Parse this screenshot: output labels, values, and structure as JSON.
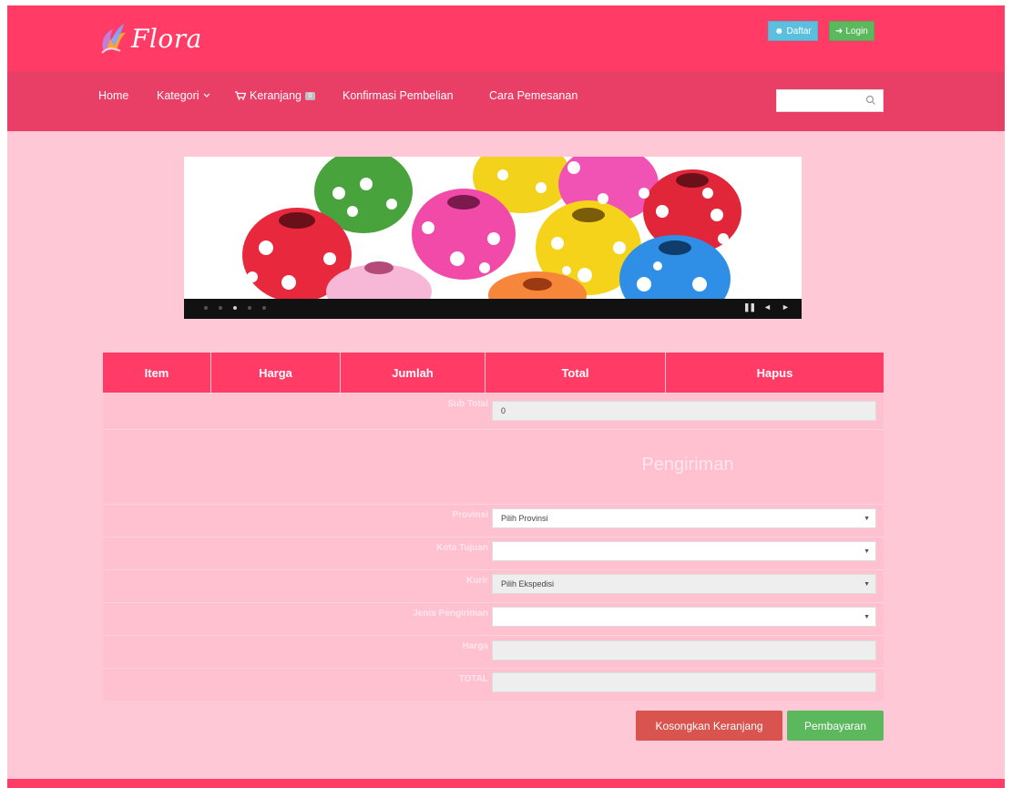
{
  "brand": {
    "name": "Flora"
  },
  "top_buttons": {
    "daftar": "Daftar",
    "login": "Login"
  },
  "nav": {
    "home": "Home",
    "kategori": "Kategori",
    "keranjang": "Keranjang",
    "keranjang_count": "0",
    "konfirmasi": "Konfirmasi Pembelian",
    "cara": "Cara Pemesanan"
  },
  "search": {
    "placeholder": "",
    "value": ""
  },
  "slider": {
    "dots": 5,
    "active_dot": 3
  },
  "table": {
    "headers": [
      "Item",
      "Harga",
      "Jumlah",
      "Total",
      "Hapus"
    ]
  },
  "form": {
    "subtotal_label": "Sub Total",
    "subtotal_value": "0",
    "section_title": "Pengiriman",
    "provinsi_label": "Provinsi",
    "provinsi_value": "Pilih Provinsi",
    "kota_label": "Kota Tujuan",
    "kota_value": "",
    "kurir_label": "Kurir",
    "kurir_value": "Pilih Ekspedisi",
    "jenis_label": "Jenis Pengiriman",
    "jenis_value": "",
    "harga_label": "Harga",
    "harga_value": "",
    "total_label": "TOTAL",
    "total_value": ""
  },
  "actions": {
    "clear": "Kosongkan Keranjang",
    "pay": "Pembayaran"
  },
  "colors": {
    "primary": "#ff3b66",
    "nav": "#e93e66",
    "background": "#ffc8d6",
    "danger": "#d9534f",
    "success": "#5cb85c",
    "info": "#5bc0de"
  }
}
